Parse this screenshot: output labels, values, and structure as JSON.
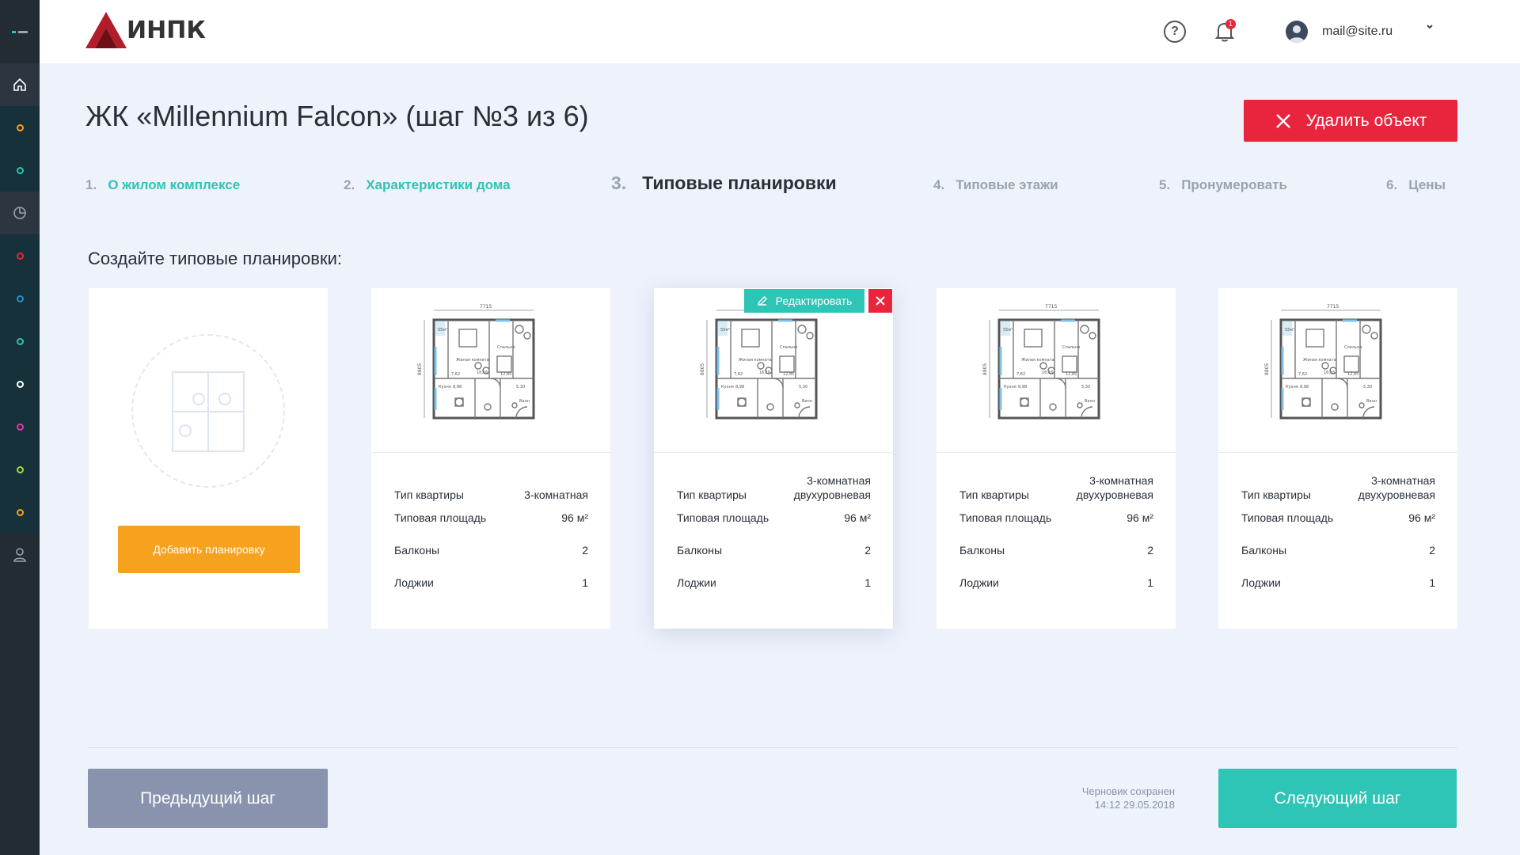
{
  "header": {
    "logo_text": "ИНПК",
    "help_icon": "?",
    "notification_count": "1",
    "user_email": "mail@site.ru",
    "dropdown_icon": "⌄"
  },
  "sidebar": {
    "dot_colors": [
      "#f7a21e",
      "#2ec4b6",
      "#e8253d",
      "#2b8ccf",
      "#2ec4b6",
      "#ffffff",
      "#d53fa0",
      "#a9d63a",
      "#f7a21e"
    ]
  },
  "page": {
    "title": "ЖК «Millennium Falcon» (шаг №3 из 6)",
    "delete_label": "Удалить объект",
    "subtitle": "Создайте типовые планировки:"
  },
  "steps": [
    {
      "num": "1.",
      "label": "О жилом комплексе",
      "state": "done"
    },
    {
      "num": "2.",
      "label": "Характеристики дома",
      "state": "done"
    },
    {
      "num": "3.",
      "label": "Типовые планировки",
      "state": "current"
    },
    {
      "num": "4.",
      "label": "Типовые этажи",
      "state": "todo"
    },
    {
      "num": "5.",
      "label": "Пронумеровать",
      "state": "todo"
    },
    {
      "num": "6.",
      "label": "Цены",
      "state": "todo"
    }
  ],
  "add_card": {
    "button_label": "Добавить планировку"
  },
  "card_labels": {
    "type": "Тип квартиры",
    "area": "Типовая площадь",
    "balconies": "Балконы",
    "loggias": "Лоджии"
  },
  "plan_text": {
    "width": "7715",
    "height": "8805",
    "room_main": "Жилая комната",
    "room_bed": "Спальня",
    "room_kitchen": "Кухня",
    "room_bath": "Ванн",
    "room_balcony": "55м²",
    "area_a": "16,16",
    "area_b": "12,85",
    "area_c": "7,62",
    "area_d": "8,98",
    "area_e": "5,30"
  },
  "cards": [
    {
      "type": "3-комнатная",
      "area": "96 м²",
      "balconies": "2",
      "loggias": "1"
    },
    {
      "type": "3-комнатная двухуровневая",
      "area": "96 м²",
      "balconies": "2",
      "loggias": "1"
    },
    {
      "type": "3-комнатная двухуровневая",
      "area": "96 м²",
      "balconies": "2",
      "loggias": "1"
    },
    {
      "type": "3-комнатная двухуровневая",
      "area": "96 м²",
      "balconies": "2",
      "loggias": "1"
    }
  ],
  "hover_actions": {
    "edit_label": "Редактировать"
  },
  "footer": {
    "prev_label": "Предыдущий шаг",
    "next_label": "Следующий шаг",
    "draft_line1": "Черновик сохранен",
    "draft_line2": "14:12 29.05.2018"
  }
}
